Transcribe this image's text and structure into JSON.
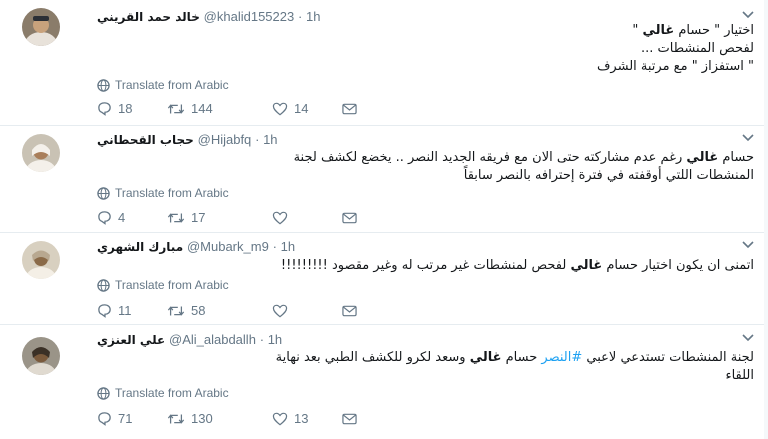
{
  "translate_label": "Translate from Arabic",
  "tweets": [
    {
      "name": "خالد حمد القريني",
      "handle": "@khalid155223",
      "time": "1h",
      "lines": [
        [
          "اختيار \" حسام ",
          {
            "b": "غالي"
          },
          " \""
        ],
        [
          "لفحص المنشطات ..."
        ],
        [
          "\" استفزاز \" مع مرتبة الشرف"
        ]
      ],
      "replies": "18",
      "retweets": "144",
      "likes": "14",
      "avatar_colors": [
        "#8a7c6a",
        "#2b2f36",
        "#e8e2da"
      ]
    },
    {
      "name": "حجاب القحطاني",
      "handle": "@Hijabfq",
      "time": "1h",
      "lines": [
        [
          "حسام ",
          {
            "b": "غالي"
          },
          " رغم عدم مشاركته حتى الان مع فريقه الجديد النصر .. يخضع لكشف لجنة"
        ],
        [
          "المنشطات اللتي أوقفته في فترة إحترافه بالنصر سابقاً"
        ]
      ],
      "replies": "4",
      "retweets": "17",
      "likes": "",
      "avatar_colors": [
        "#c9c2b4",
        "#6e6352",
        "#f4f0ea"
      ]
    },
    {
      "name": "مبارك الشهري",
      "handle": "@Mubark_m9",
      "time": "1h",
      "lines": [
        [
          "اتمنى ان يكون اختيار حسام ",
          {
            "b": "غالي"
          },
          " لفحص لمنشطات غير مرتب له وغير مقصود !!!!!!!!!"
        ]
      ],
      "replies": "11",
      "retweets": "58",
      "likes": "",
      "avatar_colors": [
        "#d8d0c0",
        "#8a6a48",
        "#b8a890"
      ]
    },
    {
      "name": "علي العنزي",
      "handle": "@Ali_alabdallh",
      "time": "1h",
      "lines": [
        [
          "لجنة المنشطات تستدعي لاعبي ",
          {
            "h": "#النصر"
          },
          " حسام ",
          {
            "b": "غالي"
          },
          " وسعد لكرو للكشف الطبي بعد نهاية"
        ],
        [
          "اللقاء"
        ]
      ],
      "replies": "71",
      "retweets": "130",
      "likes": "13",
      "avatar_colors": [
        "#9a9488",
        "#3a3026",
        "#e0dad0"
      ]
    }
  ]
}
